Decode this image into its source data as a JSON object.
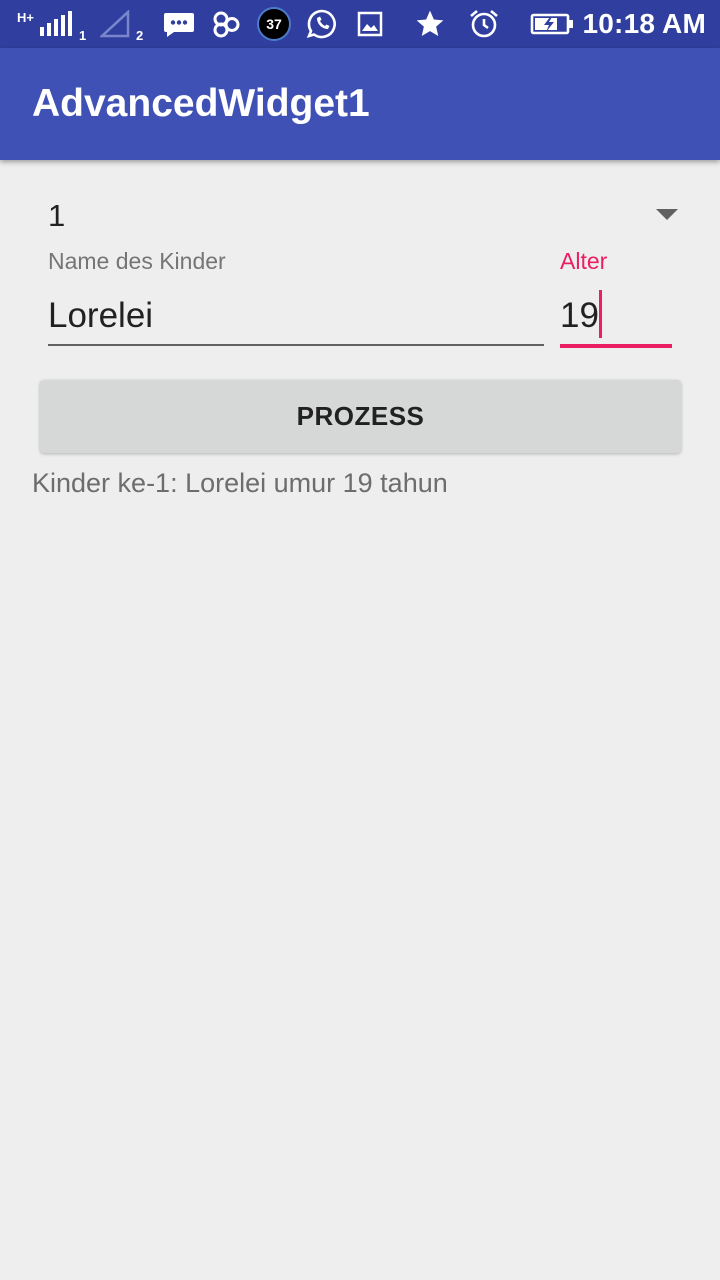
{
  "status_bar": {
    "network_type": "H+",
    "sim1_label": "1",
    "sim2_label": "2",
    "notification_count": "37",
    "time": "10:18 AM",
    "icons": [
      "signal-sim1-icon",
      "signal-sim2-icon",
      "messages-icon",
      "app-notification-icon",
      "badge-icon",
      "whatsapp-icon",
      "gallery-icon",
      "star-icon",
      "alarm-icon",
      "battery-charging-icon"
    ]
  },
  "app_bar": {
    "title": "AdvancedWidget1"
  },
  "form": {
    "spinner_value": "1",
    "name_label": "Name des Kinder",
    "name_value": "Lorelei",
    "age_label": "Alter",
    "age_value": "19",
    "process_button_label": "PROZESS",
    "result_text": "Kinder ke-1: Lorelei umur 19 tahun"
  },
  "colors": {
    "status_bar": "#303f9f",
    "app_bar": "#3f51b5",
    "accent": "#e91e63",
    "background": "#eeeeee"
  }
}
